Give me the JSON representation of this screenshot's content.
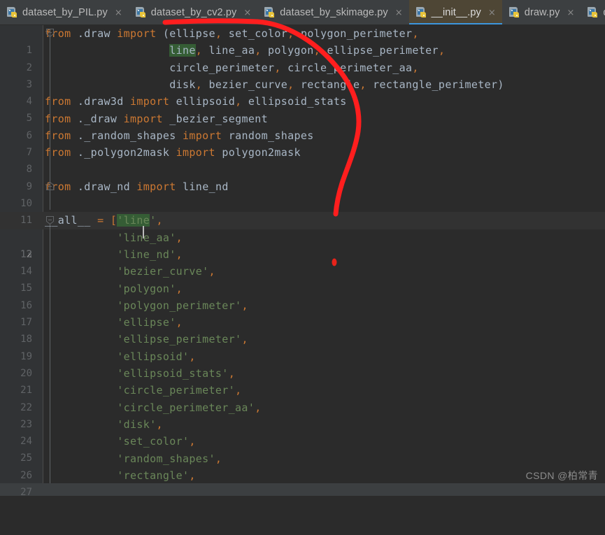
{
  "window": {
    "theme": "darcula",
    "accent_active_tab_bg": "#4E4635",
    "accent_active_tab_underline": "#3C96DD",
    "editor_bg": "#2B2B2B",
    "gutter_bg": "#313335",
    "annotation_color": "#FF1E1E"
  },
  "tabs": [
    {
      "label": "dataset_by_PIL.py",
      "icon": "python-file-icon",
      "close": "×",
      "active": false
    },
    {
      "label": "dataset_by_cv2.py",
      "icon": "python-file-icon",
      "close": "×",
      "active": false
    },
    {
      "label": "dataset_by_skimage.py",
      "icon": "python-file-icon",
      "close": "×",
      "active": false
    },
    {
      "label": "__init__.py",
      "icon": "python-file-icon",
      "close": "×",
      "active": true
    },
    {
      "label": "draw.py",
      "icon": "python-file-icon",
      "close": "×",
      "active": false
    },
    {
      "label": "data",
      "icon": "python-file-icon",
      "close": "",
      "active": false
    }
  ],
  "editor": {
    "current_line": 12,
    "caret_line": 12,
    "lines": [
      {
        "n": "1",
        "text": "from .draw import (ellipse, set_color, polygon_perimeter,"
      },
      {
        "n": "2",
        "text": "                   line, line_aa, polygon, ellipse_perimeter,"
      },
      {
        "n": "3",
        "text": "                   circle_perimeter, circle_perimeter_aa,"
      },
      {
        "n": "4",
        "text": "                   disk, bezier_curve, rectangle, rectangle_perimeter)"
      },
      {
        "n": "5",
        "text": "from .draw3d import ellipsoid, ellipsoid_stats"
      },
      {
        "n": "6",
        "text": "from ._draw import _bezier_segment"
      },
      {
        "n": "7",
        "text": "from ._random_shapes import random_shapes"
      },
      {
        "n": "8",
        "text": "from ._polygon2mask import polygon2mask"
      },
      {
        "n": "9",
        "text": ""
      },
      {
        "n": "10",
        "text": "from .draw_nd import line_nd"
      },
      {
        "n": "11",
        "text": ""
      },
      {
        "n": "12",
        "text": "__all__ = ['line',"
      },
      {
        "n": "13",
        "text": "           'line_aa',"
      },
      {
        "n": "14",
        "text": "           'line_nd',"
      },
      {
        "n": "15",
        "text": "           'bezier_curve',"
      },
      {
        "n": "16",
        "text": "           'polygon',"
      },
      {
        "n": "17",
        "text": "           'polygon_perimeter',"
      },
      {
        "n": "18",
        "text": "           'ellipse',"
      },
      {
        "n": "19",
        "text": "           'ellipse_perimeter',"
      },
      {
        "n": "20",
        "text": "           'ellipsoid',"
      },
      {
        "n": "21",
        "text": "           'ellipsoid_stats',"
      },
      {
        "n": "22",
        "text": "           'circle_perimeter',"
      },
      {
        "n": "23",
        "text": "           'circle_perimeter_aa',"
      },
      {
        "n": "24",
        "text": "           'disk',"
      },
      {
        "n": "25",
        "text": "           'set_color',"
      },
      {
        "n": "26",
        "text": "           'random_shapes',"
      },
      {
        "n": "27",
        "text": "           'rectangle',"
      }
    ],
    "fold_marker_lines": [
      "1",
      "10",
      "12"
    ],
    "highlighted_token": "line"
  },
  "watermark": {
    "text": "CSDN @柏常青"
  }
}
